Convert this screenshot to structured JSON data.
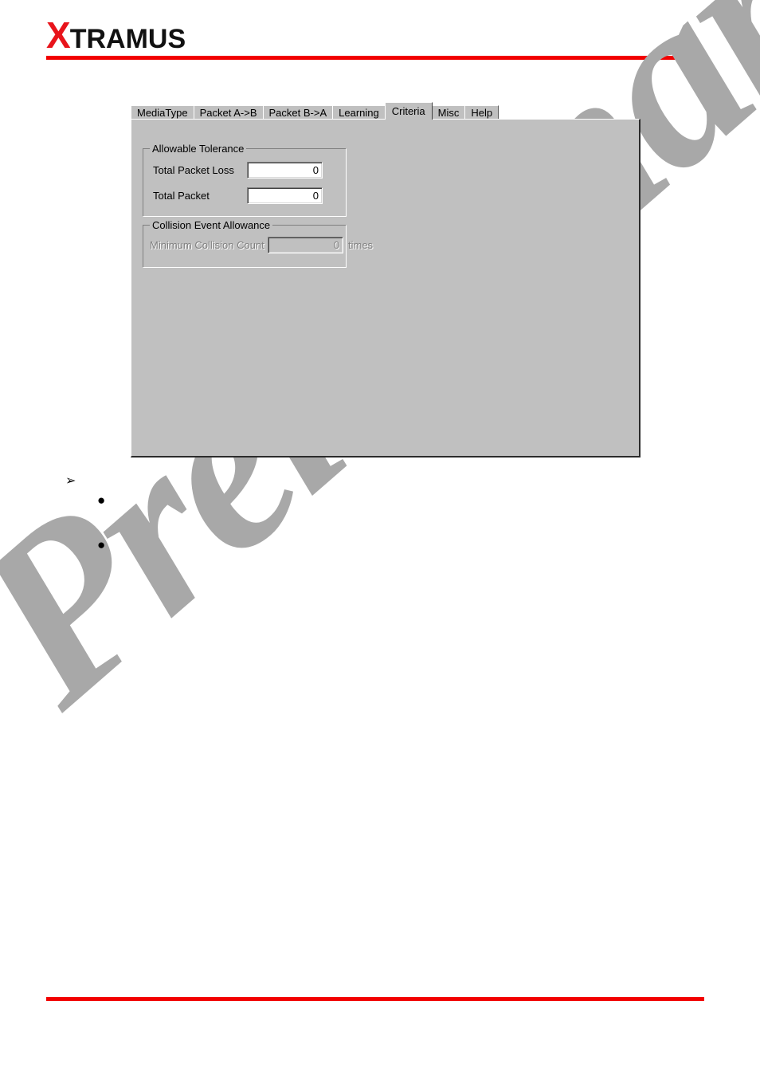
{
  "document": {
    "brand_logo_first": "X",
    "brand_logo_rest": "TRAMUS",
    "watermark_text": "Preliminary",
    "accent_color": "#f20000",
    "logo_x_color": "#e8141b",
    "panel_color": "#c0c0c0",
    "watermark_color": "#a8a8a8"
  },
  "dialog": {
    "tabs": [
      {
        "label": "MediaType",
        "selected": false
      },
      {
        "label": "Packet A->B",
        "selected": false
      },
      {
        "label": "Packet B->A",
        "selected": false
      },
      {
        "label": "Learning",
        "selected": false
      },
      {
        "label": "Criteria",
        "selected": true
      },
      {
        "label": "Misc",
        "selected": false
      },
      {
        "label": "Help",
        "selected": false
      }
    ],
    "groups": {
      "tolerance": {
        "title": "Allowable Tolerance",
        "enabled": true,
        "fields": [
          {
            "label": "Total Packet Loss",
            "value": "0",
            "placeholder": "0",
            "enabled": true
          },
          {
            "label": "Total Packet",
            "value": "0",
            "placeholder": "0",
            "enabled": true
          }
        ]
      },
      "collision": {
        "title": "Collision Event Allowance",
        "enabled": false,
        "fields": [
          {
            "label": "Minimum Collision Count",
            "value": "0",
            "placeholder": "0",
            "unit": "times",
            "enabled": false
          }
        ]
      }
    }
  },
  "body": {
    "items": [
      {
        "marker": "arrow-bullet",
        "glyph": "➢",
        "text": ""
      },
      {
        "marker": "round-bullet",
        "glyph": "●",
        "text": ""
      },
      {
        "marker": "round-bullet",
        "glyph": "●",
        "text": ""
      }
    ]
  }
}
